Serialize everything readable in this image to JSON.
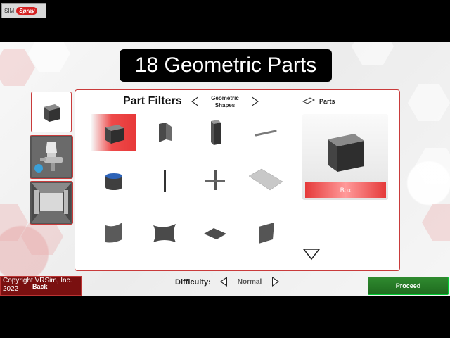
{
  "branding": {
    "prefix": "SIM",
    "name": "Spray"
  },
  "title": "18 Geometric Parts",
  "filters": {
    "label": "Part Filters",
    "value": "Geometric Shapes"
  },
  "parts_header": {
    "label": "Parts",
    "icon": "flat-panel-icon"
  },
  "preview": {
    "name": "Box"
  },
  "parts_grid": [
    {
      "name": "box",
      "selected": true
    },
    {
      "name": "angle"
    },
    {
      "name": "rect-column"
    },
    {
      "name": "rod"
    },
    {
      "name": "cylinder"
    },
    {
      "name": "thin-bar"
    },
    {
      "name": "cross"
    },
    {
      "name": "flat-plate"
    },
    {
      "name": "curved-panel"
    },
    {
      "name": "concave-panel"
    },
    {
      "name": "small-plate"
    },
    {
      "name": "tilted-panel"
    }
  ],
  "difficulty": {
    "label": "Difficulty:",
    "value": "Normal"
  },
  "back": {
    "label": "Back"
  },
  "copyright": "Copyright VRSim, Inc. 2022",
  "proceed": {
    "label": "Proceed"
  },
  "colors": {
    "accent": "#d42222",
    "proceed": "#1f6b1f",
    "back": "#7a1010"
  }
}
